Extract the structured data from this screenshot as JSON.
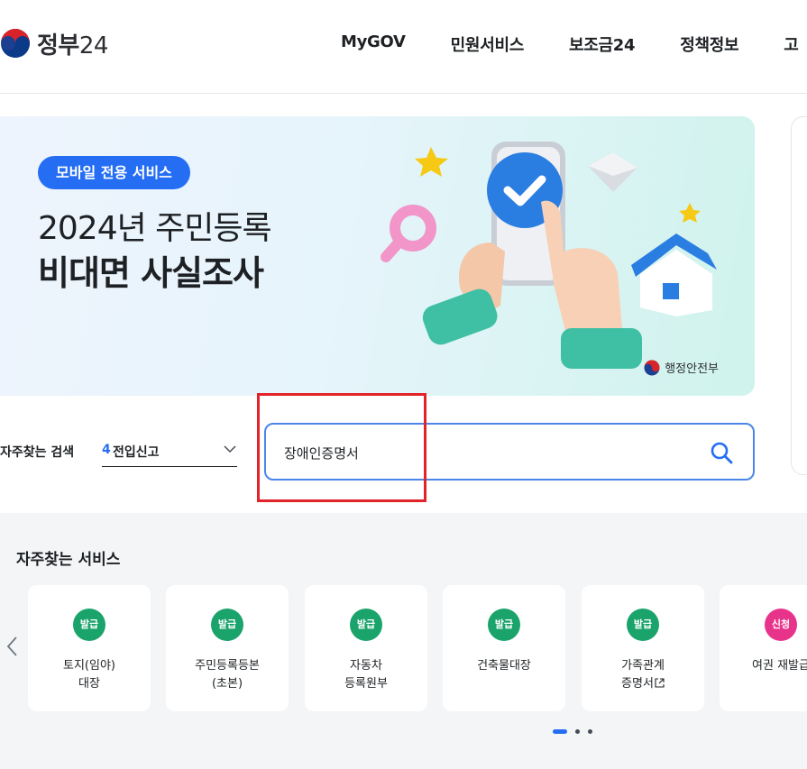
{
  "header": {
    "logo_text": "정부",
    "logo_num": "24",
    "nav": [
      "MyGOV",
      "민원서비스",
      "보조금24",
      "정책정보",
      "고"
    ]
  },
  "banner": {
    "badge": "모바일 전용 서비스",
    "line1": "2024년 주민등록",
    "line2": "비대면 사실조사",
    "ministry": "행정안전부"
  },
  "search": {
    "freq_label": "자주찾는 검색",
    "freq_rank": "4",
    "freq_term": "전입신고",
    "query": "장애인증명서"
  },
  "services": {
    "title": "자주찾는 서비스",
    "items": [
      {
        "badge": "발급",
        "line1": "토지(임야)",
        "line2": "대장",
        "badge_color": "#1aa36b"
      },
      {
        "badge": "발급",
        "line1": "주민등록등본",
        "line2": "(초본)",
        "badge_color": "#1aa36b"
      },
      {
        "badge": "발급",
        "line1": "자동차",
        "line2": "등록원부",
        "badge_color": "#1aa36b"
      },
      {
        "badge": "발급",
        "line1": "건축물대장",
        "line2": "",
        "badge_color": "#1aa36b"
      },
      {
        "badge": "발급",
        "line1": "가족관계",
        "line2": "증명서",
        "badge_color": "#1aa36b"
      },
      {
        "badge": "신청",
        "line1": "여권 재발급",
        "line2": "",
        "badge_color": "#e8338b"
      }
    ]
  },
  "colors": {
    "accent": "#256ef4",
    "highlight_box": "#e2232a"
  }
}
